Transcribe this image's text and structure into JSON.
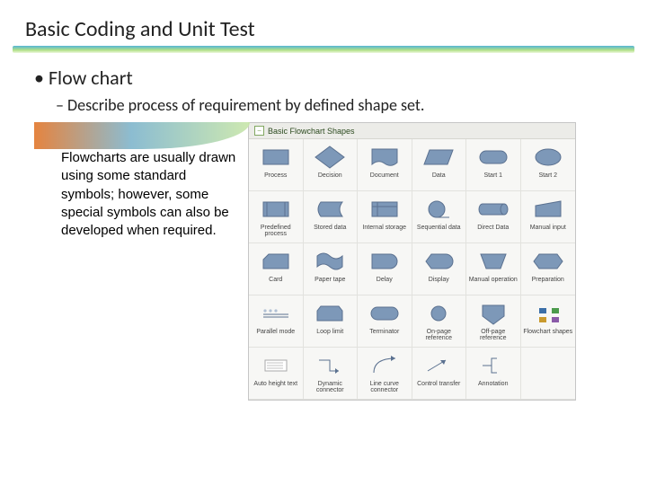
{
  "title": "Basic Coding and Unit Test",
  "bullet1": "Flow chart",
  "bullet2": "Describe process of requirement by defined shape set.",
  "left_text": "Flowcharts are usually drawn using some standard symbols; however, some special symbols can also be developed when required.",
  "palette": {
    "title": "Basic Flowchart Shapes",
    "shapes": [
      {
        "label": "Process",
        "kind": "rect"
      },
      {
        "label": "Decision",
        "kind": "diamond"
      },
      {
        "label": "Document",
        "kind": "document"
      },
      {
        "label": "Data",
        "kind": "parallelogram"
      },
      {
        "label": "Start 1",
        "kind": "terminator"
      },
      {
        "label": "Start 2",
        "kind": "ellipse"
      },
      {
        "label": "Predefined process",
        "kind": "predef"
      },
      {
        "label": "Stored data",
        "kind": "stored"
      },
      {
        "label": "Internal storage",
        "kind": "internal"
      },
      {
        "label": "Sequential data",
        "kind": "seqdata"
      },
      {
        "label": "Direct Data",
        "kind": "cylinder"
      },
      {
        "label": "Manual input",
        "kind": "manualin"
      },
      {
        "label": "Card",
        "kind": "card"
      },
      {
        "label": "Paper tape",
        "kind": "papertape"
      },
      {
        "label": "Delay",
        "kind": "delay"
      },
      {
        "label": "Display",
        "kind": "display"
      },
      {
        "label": "Manual operation",
        "kind": "manualop"
      },
      {
        "label": "Preparation",
        "kind": "prep"
      },
      {
        "label": "Parallel mode",
        "kind": "parallel"
      },
      {
        "label": "Loop limit",
        "kind": "looplimit"
      },
      {
        "label": "Terminator",
        "kind": "terminator"
      },
      {
        "label": "On-page reference",
        "kind": "circle"
      },
      {
        "label": "Off-page reference",
        "kind": "offpage"
      },
      {
        "label": "Flowchart shapes",
        "kind": "mini"
      },
      {
        "label": "Auto height text",
        "kind": "textbox"
      },
      {
        "label": "Dynamic connector",
        "kind": "dynconn"
      },
      {
        "label": "Line curve connector",
        "kind": "curvconn"
      },
      {
        "label": "Control transfer",
        "kind": "ctrl"
      },
      {
        "label": "Annotation",
        "kind": "annot"
      }
    ]
  }
}
